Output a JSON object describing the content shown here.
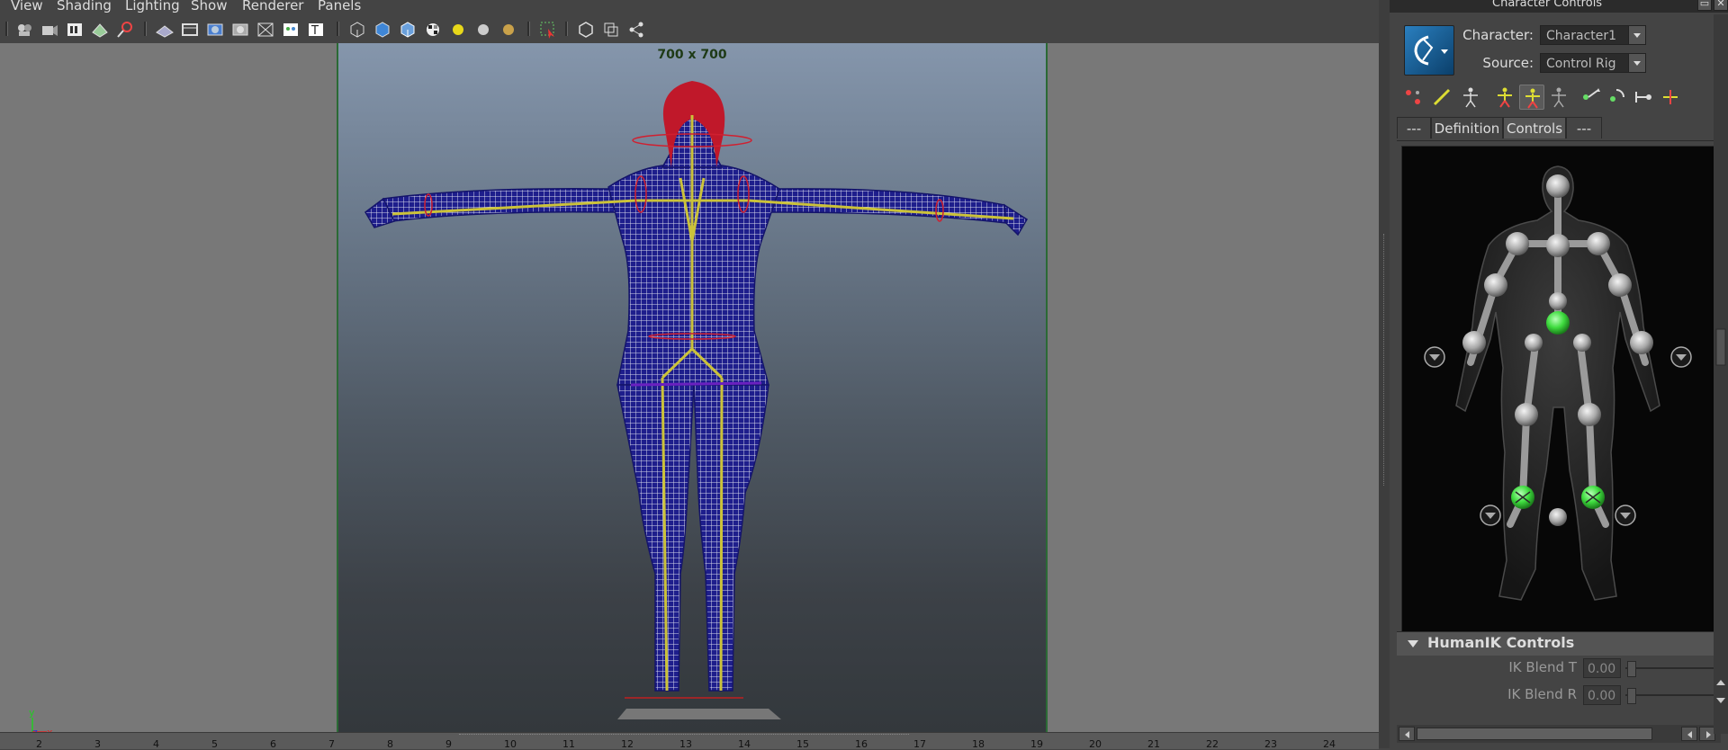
{
  "menubar": {
    "items": [
      "View",
      "Shading",
      "Lighting",
      "Show",
      "Renderer",
      "Panels"
    ]
  },
  "viewport": {
    "resolution_label": "700 x 700",
    "axis": {
      "y": "y",
      "z": "z",
      "x": "x"
    }
  },
  "timeline": {
    "ticks": [
      "2",
      "3",
      "4",
      "5",
      "6",
      "7",
      "8",
      "9",
      "10",
      "11",
      "12",
      "13",
      "14",
      "15",
      "16",
      "17",
      "18",
      "19",
      "20",
      "21",
      "22",
      "23",
      "24"
    ]
  },
  "panel": {
    "title": "Character Controls",
    "character_label": "Character:",
    "character_value": "Character1",
    "source_label": "Source:",
    "source_value": "Control Rig",
    "tabs": [
      "---",
      "Definition",
      "Controls",
      "---"
    ],
    "active_tab": "Controls",
    "humanik": {
      "title": "HumanIK Controls",
      "sliders": [
        {
          "label": "IK Blend T",
          "value": "0.00"
        },
        {
          "label": "IK Blend R",
          "value": "0.00"
        }
      ]
    }
  },
  "colors": {
    "active_effector": "#3fdc3f",
    "frame_border": "#2b6a35",
    "logo_blue": "#2a7fbf"
  }
}
